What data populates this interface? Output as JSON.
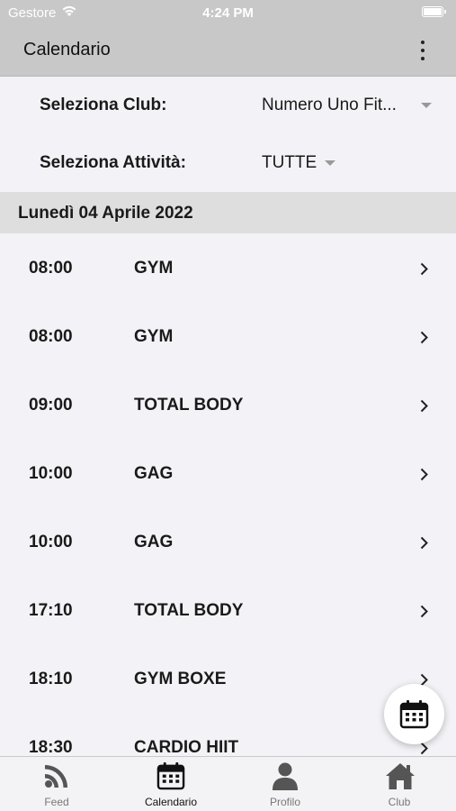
{
  "status_bar": {
    "carrier": "Gestore",
    "time": "4:24 PM"
  },
  "app_bar": {
    "title": "Calendario",
    "menu_icon": "more-vert-icon"
  },
  "filters": {
    "club": {
      "label": "Seleziona Club:",
      "value": "Numero Uno Fit..."
    },
    "activity": {
      "label": "Seleziona Attività:",
      "value": "TUTTE"
    }
  },
  "date_header": "Lunedì 04 Aprile 2022",
  "classes": [
    {
      "time": "08:00",
      "activity": "GYM"
    },
    {
      "time": "08:00",
      "activity": "GYM"
    },
    {
      "time": "09:00",
      "activity": "TOTAL BODY"
    },
    {
      "time": "10:00",
      "activity": "GAG"
    },
    {
      "time": "10:00",
      "activity": "GAG"
    },
    {
      "time": "17:10",
      "activity": "TOTAL BODY"
    },
    {
      "time": "18:10",
      "activity": "GYM BOXE"
    },
    {
      "time": "18:30",
      "activity": "CARDIO HIIT"
    }
  ],
  "fab": {
    "icon": "calendar-icon"
  },
  "tabs": [
    {
      "label": "Feed",
      "icon": "rss-icon",
      "active": false
    },
    {
      "label": "Calendario",
      "icon": "calendar-icon",
      "active": true
    },
    {
      "label": "Profilo",
      "icon": "person-icon",
      "active": false
    },
    {
      "label": "Club",
      "icon": "home-icon",
      "active": false
    }
  ],
  "colors": {
    "app_bar": "#c8c8c8",
    "background": "#f3f3f7",
    "date_header": "#dedede",
    "active_tab": "#111111",
    "inactive_tab": "#777777"
  }
}
